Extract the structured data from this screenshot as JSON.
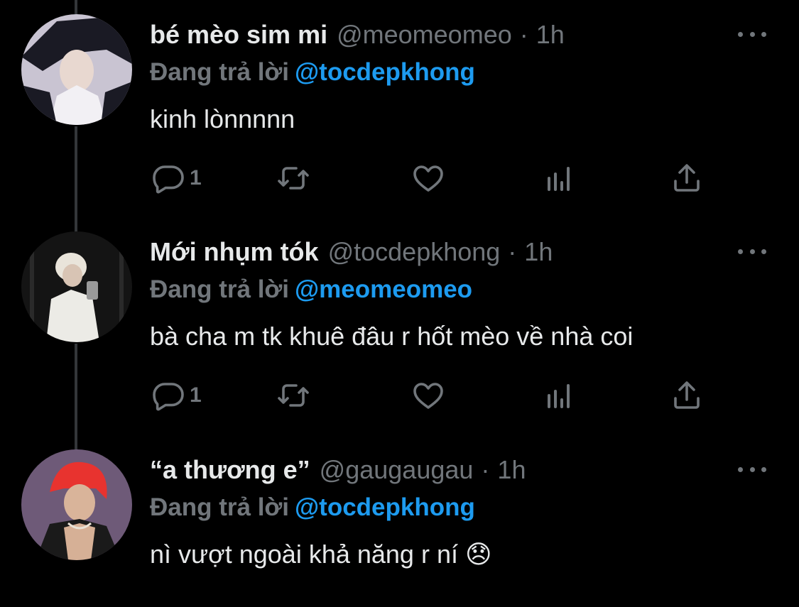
{
  "tweets": [
    {
      "display_name": "bé mèo sim mi",
      "handle": "@meomeomeo",
      "separator": "·",
      "time": "1h",
      "reply_prefix": "Đang trả lời",
      "reply_to": "@tocdepkhong",
      "text": "kinh lònnnnn",
      "reply_count": "1",
      "avatar_colors": {
        "bg": "#c9c4d2",
        "accent": "#1a1a24"
      }
    },
    {
      "display_name": "Mới nhụm tók",
      "handle": "@tocdepkhong",
      "separator": "·",
      "time": "1h",
      "reply_prefix": "Đang trả lời",
      "reply_to": "@meomeomeo",
      "text": "bà cha m tk khuê đâu r hốt mèo về nhà coi",
      "reply_count": "1",
      "avatar_colors": {
        "bg": "#141414",
        "accent": "#e9e4da"
      }
    },
    {
      "display_name": "“a thương e”",
      "handle": "@gaugaugau",
      "separator": "·",
      "time": "1h",
      "reply_prefix": "Đang trả lời",
      "reply_to": "@tocdepkhong",
      "text": "nì vượt ngoài khả năng r ní 😞",
      "avatar_colors": {
        "bg": "#6e5a78",
        "accent": "#e8332f"
      }
    }
  ],
  "icons": [
    "reply-icon",
    "retweet-icon",
    "like-icon",
    "analytics-icon",
    "share-icon",
    "more-icon"
  ],
  "colors": {
    "background": "#000000",
    "text": "#e7e9ea",
    "secondary": "#71767b",
    "link": "#1d9bf0",
    "thread_line": "#333639"
  }
}
